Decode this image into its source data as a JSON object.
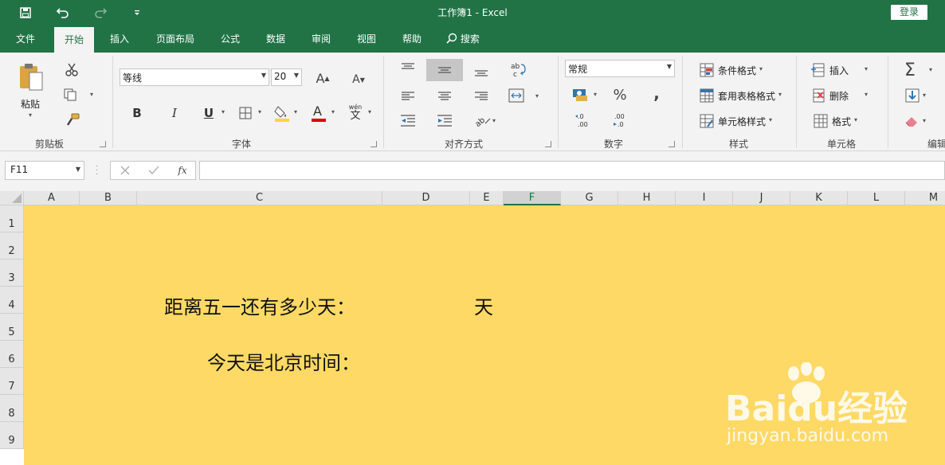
{
  "titlebar": {
    "title": "工作簿1  -  Excel",
    "login": "登录"
  },
  "tabs": [
    "文件",
    "开始",
    "插入",
    "页面布局",
    "公式",
    "数据",
    "审阅",
    "视图",
    "帮助",
    "搜索"
  ],
  "ribbon": {
    "clipboard": {
      "paste": "粘贴",
      "label": "剪贴板"
    },
    "font": {
      "name": "等线",
      "size": "20",
      "label": "字体",
      "bold": "B",
      "italic": "I",
      "underline": "U",
      "phonetic_top": "wén",
      "phonetic_bottom": "文"
    },
    "alignment": {
      "label": "对齐方式"
    },
    "number": {
      "format": "常规",
      "percent": "%",
      "comma": ",",
      "label": "数字"
    },
    "styles": {
      "conditional": "条件格式",
      "table": "套用表格格式",
      "cell": "单元格样式",
      "label": "样式"
    },
    "cells": {
      "insert": "插入",
      "delete": "删除",
      "format": "格式",
      "label": "单元格"
    },
    "editing": {
      "sigma": "Σ",
      "label": "编辑"
    }
  },
  "formula_bar": {
    "name_box": "F11",
    "fx": "fx",
    "content": ""
  },
  "sheet": {
    "columns": [
      "A",
      "B",
      "C",
      "D",
      "E",
      "F",
      "G",
      "H",
      "I",
      "J",
      "K",
      "L",
      "M"
    ],
    "selected_column": "F",
    "rows": [
      "1",
      "2",
      "3",
      "4",
      "5",
      "6",
      "7",
      "8",
      "9"
    ],
    "fill_color": "#FFD966",
    "cells": {
      "C4": "距离五一还有多少天：",
      "E4": "天",
      "C6": "今天是北京时间："
    }
  },
  "watermark": {
    "brand": "Baidu经验",
    "url": "jingyan.baidu.com"
  },
  "colors": {
    "accent": "#217346",
    "font_red": "#e00000",
    "highlight_yellow": "#ffd43b"
  }
}
